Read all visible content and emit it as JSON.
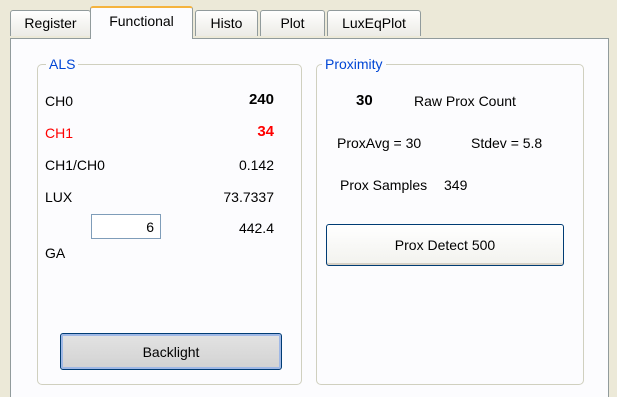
{
  "tabs": [
    {
      "label": "Register"
    },
    {
      "label": "Functional"
    },
    {
      "label": "Histo"
    },
    {
      "label": "Plot"
    },
    {
      "label": "LuxEqPlot"
    }
  ],
  "active_tab": "Functional",
  "als": {
    "title": "ALS",
    "ch0": {
      "label": "CH0",
      "value": "240"
    },
    "ch1": {
      "label": "CH1",
      "value": "34"
    },
    "ratio": {
      "label": "CH1/CH0",
      "value": "0.142"
    },
    "lux": {
      "label": "LUX",
      "value": "73.7337"
    },
    "ga": {
      "label": "GA",
      "input_value": "6",
      "value": "442.4"
    },
    "backlight_button": "Backlight"
  },
  "proximity": {
    "title": "Proximity",
    "raw_count_value": "30",
    "raw_count_label": "Raw Prox Count",
    "prox_avg": "ProxAvg = 30",
    "stdev": "Stdev = 5.8",
    "samples_label": "Prox Samples",
    "samples_value": "349",
    "detect_button": "Prox Detect 500"
  },
  "colors": {
    "legend_blue": "#0046d5",
    "ch1_red": "#ff0000",
    "active_tab_accent": "#f5b33d"
  }
}
